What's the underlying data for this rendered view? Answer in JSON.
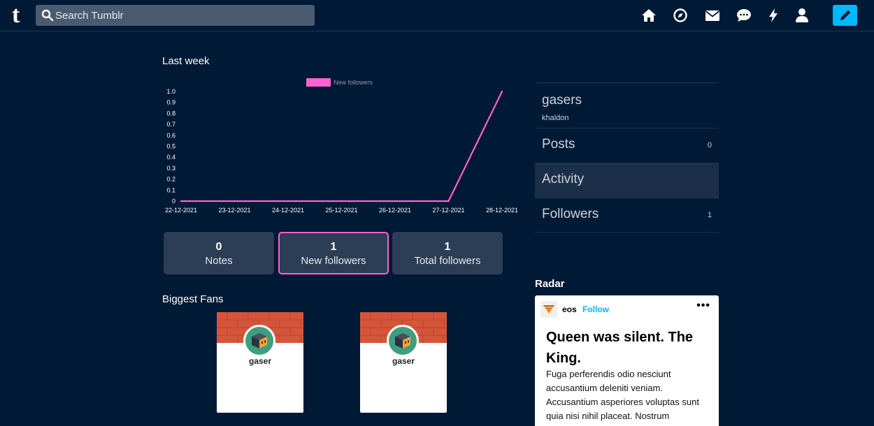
{
  "header": {
    "logo": "t",
    "search_placeholder": "Search Tumblr",
    "nav_icons": [
      "home-icon",
      "explore-icon",
      "inbox-icon",
      "messages-icon",
      "activity-icon",
      "account-icon"
    ],
    "compose_icon": "pencil-icon"
  },
  "chart_section": {
    "title": "Last week",
    "chart_data": {
      "type": "line",
      "x": [
        "22-12-2021",
        "23-12-2021",
        "24-12-2021",
        "25-12-2021",
        "26-12-2021",
        "27-12-2021",
        "28-12-2021"
      ],
      "series": [
        {
          "name": "New followers",
          "values": [
            0,
            0,
            0,
            0,
            0,
            0,
            1
          ],
          "color": "#ff62ce"
        }
      ],
      "ylim": [
        0,
        1
      ],
      "yticks": [
        "0",
        "0.1",
        "0.2",
        "0.3",
        "0.4",
        "0.5",
        "0.6",
        "0.7",
        "0.8",
        "0.9",
        "1.0"
      ],
      "legend": "top-center",
      "grid": false
    }
  },
  "stats": [
    {
      "value": "0",
      "label": "Notes"
    },
    {
      "value": "1",
      "label": "New followers"
    },
    {
      "value": "1",
      "label": "Total followers"
    }
  ],
  "fans": {
    "title": "Biggest Fans",
    "items": [
      {
        "name": "gaser"
      },
      {
        "name": "gaser"
      }
    ]
  },
  "blog": {
    "name": "gasers",
    "subtitle": "khaldon",
    "menu": [
      {
        "label": "Posts",
        "count": "0"
      },
      {
        "label": "Activity",
        "count": ""
      },
      {
        "label": "Followers",
        "count": "1"
      }
    ]
  },
  "radar": {
    "title": "Radar",
    "post": {
      "user": "eos",
      "follow_label": "Follow",
      "more_label": "•••",
      "title": "Queen was silent. The King.",
      "body": "Fuga perferendis odio nesciunt accusantium deleniti veniam. Accusantium asperiores voluptas sunt quia nisi nihil placeat. Nostrum"
    }
  },
  "colors": {
    "background": "#001935",
    "accent": "#00b8ff",
    "highlight": "#ff62ce",
    "card": "#2c3e55"
  }
}
